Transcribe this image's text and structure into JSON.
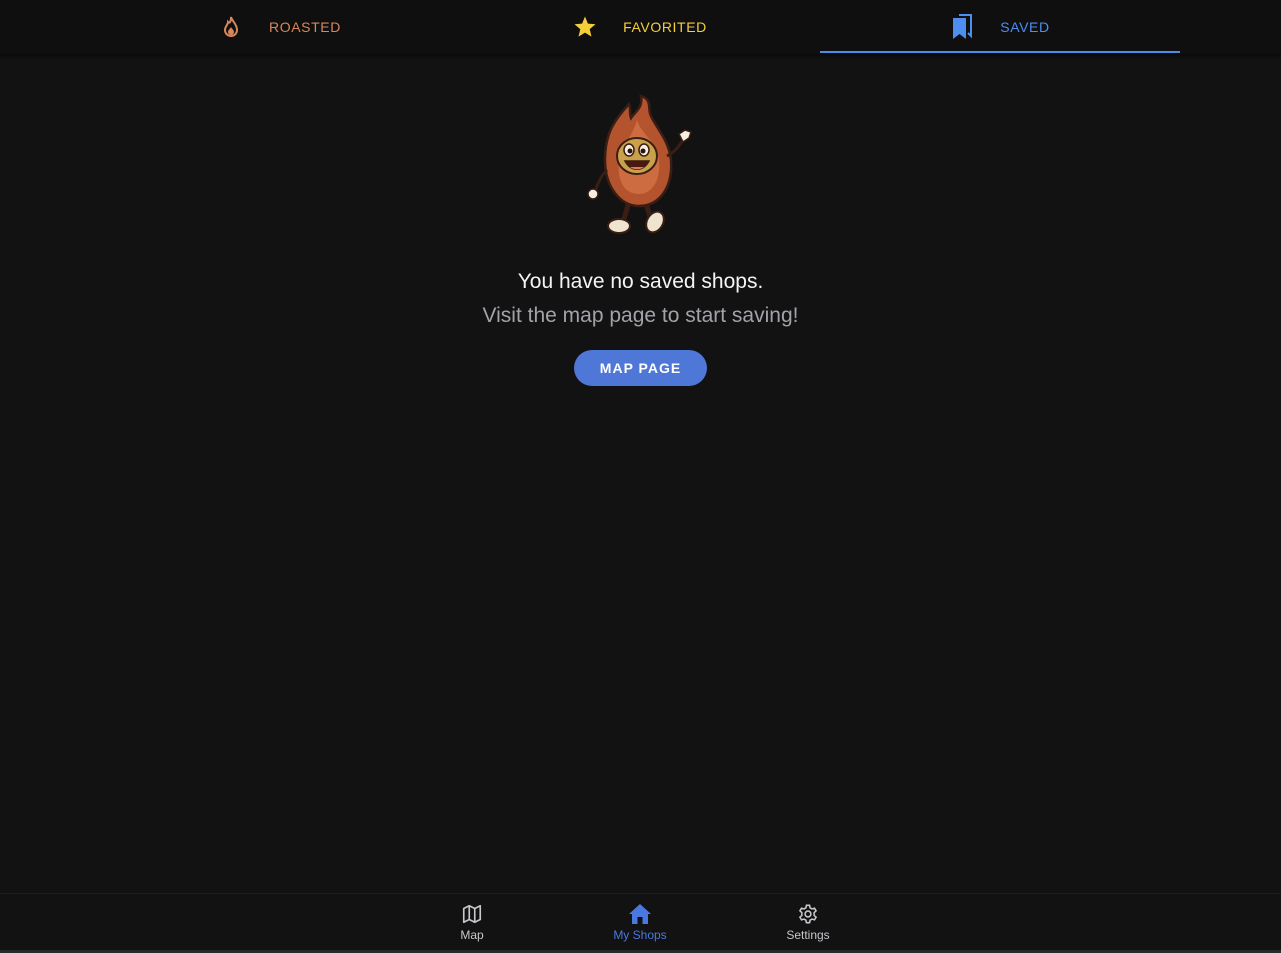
{
  "tabs": [
    {
      "label": "ROASTED",
      "icon": "flame-icon",
      "color": "#d8875a"
    },
    {
      "label": "FAVORITED",
      "icon": "star-icon",
      "color": "#f4cf3a"
    },
    {
      "label": "SAVED",
      "icon": "bookmarks-icon",
      "color": "#4d8ef0",
      "active": true
    }
  ],
  "empty_state": {
    "illustration": "flame-mascot-waving",
    "headline": "You have no saved shops.",
    "subline": "Visit the map page to start saving!",
    "button_label": "MAP PAGE"
  },
  "bottom_nav": [
    {
      "label": "Map",
      "icon": "map-icon"
    },
    {
      "label": "My Shops",
      "icon": "home-icon",
      "active": true,
      "color": "#4a78e0"
    },
    {
      "label": "Settings",
      "icon": "gear-icon"
    }
  ]
}
